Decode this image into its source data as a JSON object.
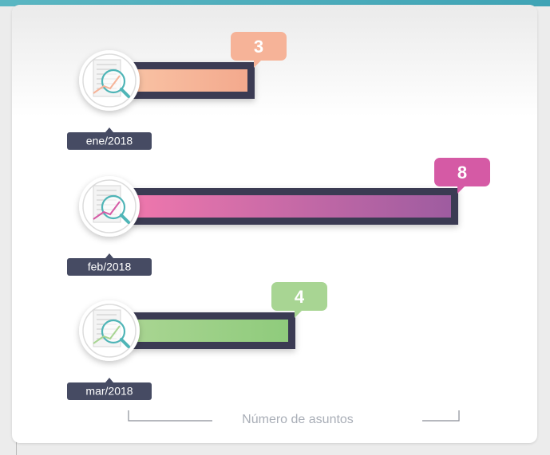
{
  "chart_data": {
    "type": "bar",
    "orientation": "horizontal",
    "categories": [
      "ene/2018",
      "feb/2018",
      "mar/2018"
    ],
    "values": [
      3,
      8,
      4
    ],
    "value_labels": [
      "3",
      "8",
      "4"
    ],
    "xlabel": "Número de asuntos",
    "xlim": [
      0,
      8
    ],
    "grid": false,
    "colors": [
      {
        "start": "#f9c2a4",
        "end": "#f3a98d",
        "badge": "#f6b398"
      },
      {
        "start": "#ef77ad",
        "end": "#9e5ca0",
        "badge": "#d55aa5"
      },
      {
        "start": "#a9d592",
        "end": "#8fcb7c",
        "badge": "#a8d593"
      }
    ],
    "track_color": "#3b3a52",
    "label_background": "#464b63",
    "icon": "chart-search-icon"
  }
}
